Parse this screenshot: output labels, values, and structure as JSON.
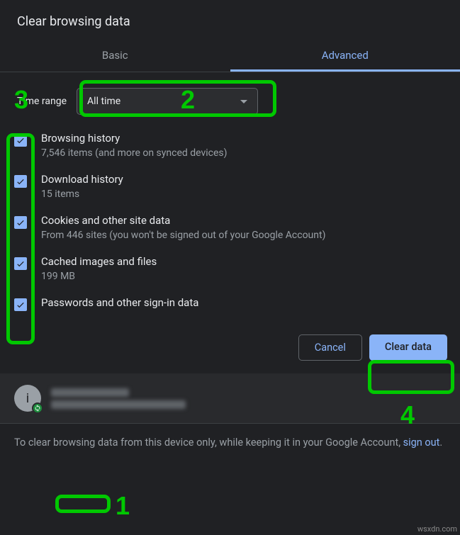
{
  "dialog": {
    "title": "Clear browsing data",
    "tabs": {
      "basic": "Basic",
      "advanced": "Advanced"
    },
    "time_range": {
      "label": "Time range",
      "value": "All time"
    },
    "options": [
      {
        "name": "Browsing history",
        "desc": "7,546 items (and more on synced devices)"
      },
      {
        "name": "Download history",
        "desc": "15 items"
      },
      {
        "name": "Cookies and other site data",
        "desc": "From 446 sites (you won't be signed out of your Google Account)"
      },
      {
        "name": "Cached images and files",
        "desc": "199 MB"
      },
      {
        "name": "Passwords and other sign-in data",
        "desc": ""
      }
    ],
    "buttons": {
      "cancel": "Cancel",
      "clear": "Clear data"
    },
    "account": {
      "avatar_letter": "i"
    },
    "footer": {
      "prefix": "To clear browsing data from this device only, while keeping it in your Google Account, ",
      "link": "sign out",
      "suffix": "."
    }
  },
  "annotations": {
    "n1": "1",
    "n2": "2",
    "n3": "3",
    "n4": "4"
  },
  "watermark": "wsxdn.com"
}
